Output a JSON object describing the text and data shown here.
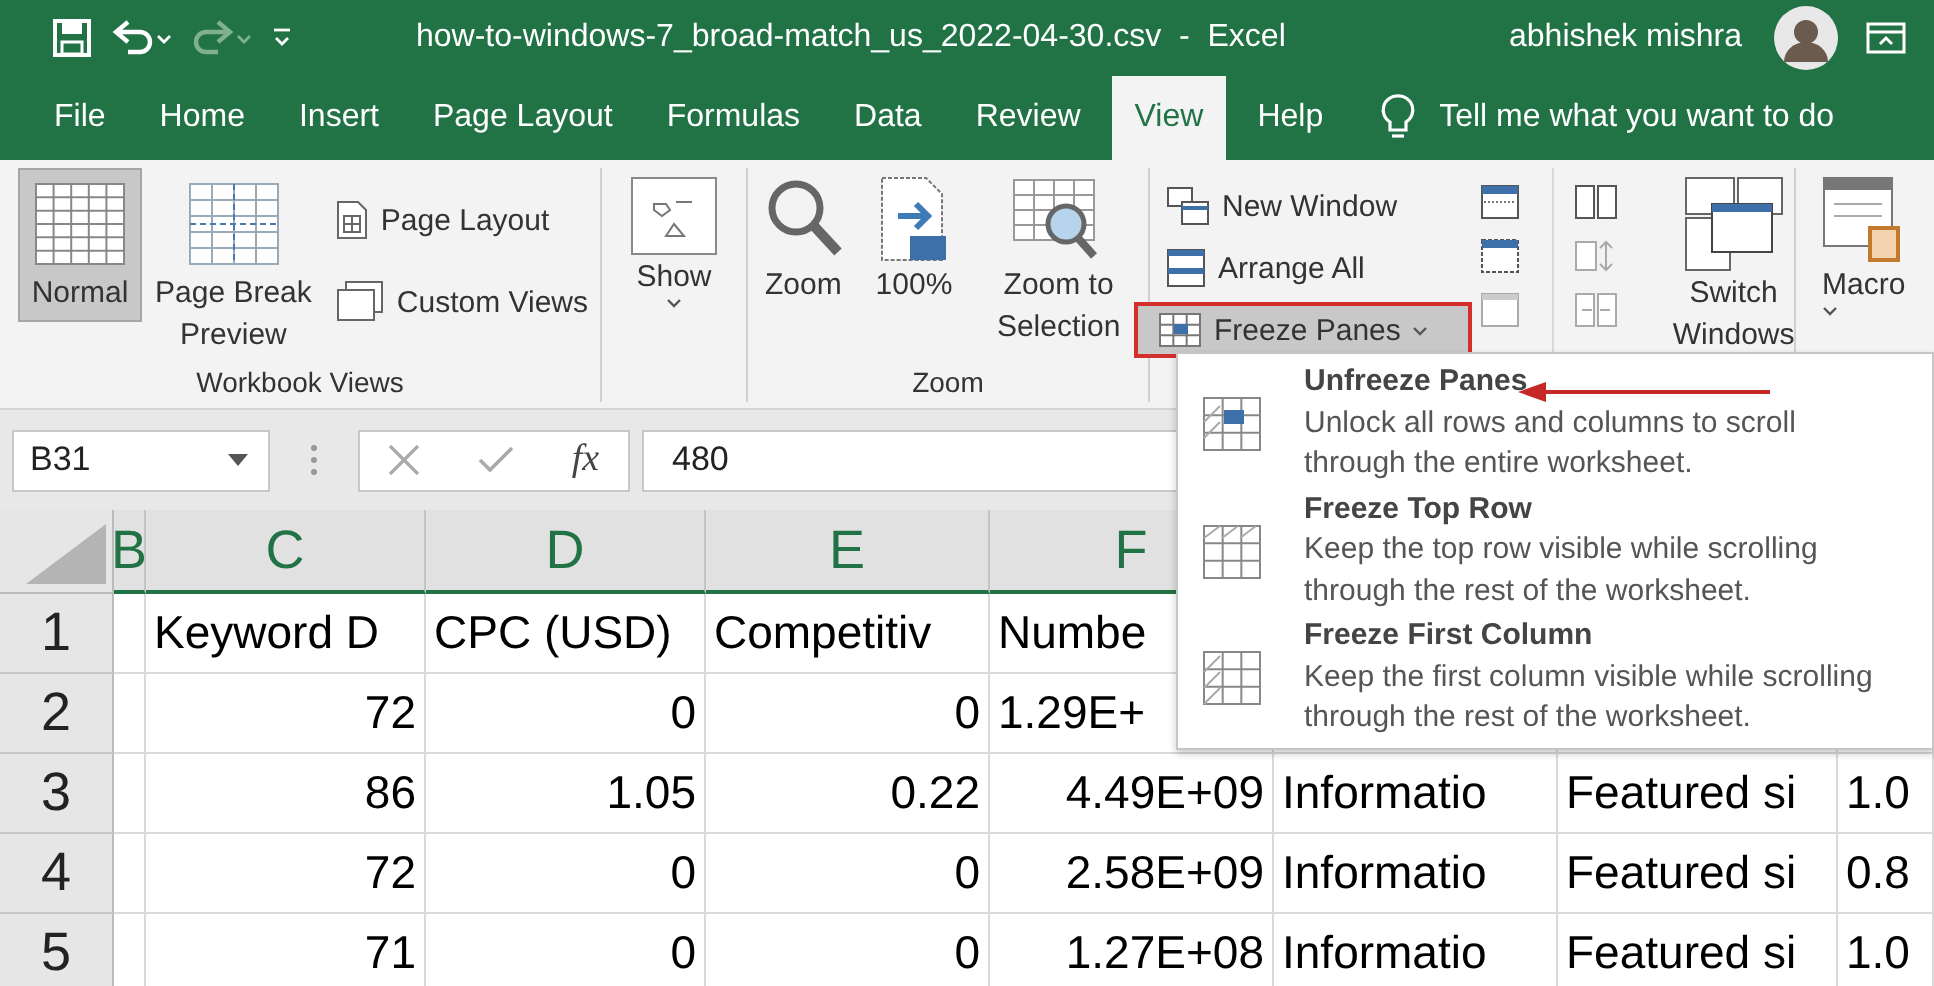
{
  "title_bar": {
    "title": "how-to-windows-7_broad-match_us_2022-04-30.csv  -  Excel",
    "user": "abhishek mishra"
  },
  "tabs": [
    {
      "label": "File",
      "selected": false
    },
    {
      "label": "Home",
      "selected": false
    },
    {
      "label": "Insert",
      "selected": false
    },
    {
      "label": "Page Layout",
      "selected": false
    },
    {
      "label": "Formulas",
      "selected": false
    },
    {
      "label": "Data",
      "selected": false
    },
    {
      "label": "Review",
      "selected": false
    },
    {
      "label": "View",
      "selected": true
    },
    {
      "label": "Help",
      "selected": false
    }
  ],
  "tell_me": "Tell me what you want to do",
  "workbook_views": {
    "label": "Workbook Views",
    "views": [
      {
        "label": "Normal",
        "selected": true
      },
      {
        "label": "Page Break Preview",
        "selected": false
      },
      {
        "label": "Page Layout",
        "selected": false
      },
      {
        "label": "Custom Views",
        "selected": false
      }
    ]
  },
  "show": {
    "label": "Show"
  },
  "zoom_group": {
    "label": "Zoom",
    "buttons": [
      "Zoom",
      "100%",
      "Zoom to Selection"
    ]
  },
  "window_group": {
    "new_window": "New Window",
    "arrange_all": "Arrange All",
    "freeze_panes": {
      "label": "Freeze Panes",
      "expanded": true,
      "highlighted": true
    },
    "switch_windows": "Switch Windows"
  },
  "macros": {
    "label": "Macro"
  },
  "freeze_menu": [
    {
      "title": "Unfreeze Panes",
      "description": "Unlock all rows and columns to scroll through the entire worksheet.",
      "pointed": true
    },
    {
      "title": "Freeze Top Row",
      "description": "Keep the top row visible while scrolling through the rest of the worksheet.",
      "pointed": false
    },
    {
      "title": "Freeze First Column",
      "description": "Keep the first column visible while scrolling through the rest of the worksheet.",
      "pointed": false
    }
  ],
  "formula_bar": {
    "name_box": "B31",
    "function_label": "fx",
    "value": "480"
  },
  "sheet": {
    "columns": [
      "B",
      "C",
      "D",
      "E",
      "F"
    ],
    "rows": [
      {
        "number": "1",
        "cells": [
          null,
          {
            "value": "Keyword D",
            "kind": "text"
          },
          {
            "value": "CPC (USD)",
            "kind": "text"
          },
          {
            "value": "Competitiv",
            "kind": "text"
          },
          {
            "value": "Numbe",
            "kind": "text"
          },
          null,
          null,
          null
        ]
      },
      {
        "number": "2",
        "cells": [
          null,
          {
            "value": "72",
            "kind": "number"
          },
          {
            "value": "0",
            "kind": "number"
          },
          {
            "value": "0",
            "kind": "number"
          },
          {
            "value": "1.29E+",
            "kind": "text"
          },
          null,
          null,
          null
        ]
      },
      {
        "number": "3",
        "cells": [
          null,
          {
            "value": "86",
            "kind": "number"
          },
          {
            "value": "1.05",
            "kind": "number"
          },
          {
            "value": "0.22",
            "kind": "number"
          },
          {
            "value": "4.49E+09",
            "kind": "number"
          },
          {
            "value": "Informatio",
            "kind": "text"
          },
          {
            "value": "Featured si",
            "kind": "text"
          },
          {
            "value": "1.0",
            "kind": "text"
          }
        ]
      },
      {
        "number": "4",
        "cells": [
          null,
          {
            "value": "72",
            "kind": "number"
          },
          {
            "value": "0",
            "kind": "number"
          },
          {
            "value": "0",
            "kind": "number"
          },
          {
            "value": "2.58E+09",
            "kind": "number"
          },
          {
            "value": "Informatio",
            "kind": "text"
          },
          {
            "value": "Featured si",
            "kind": "text"
          },
          {
            "value": "0.8",
            "kind": "text"
          }
        ]
      },
      {
        "number": "5",
        "cells": [
          null,
          {
            "value": "71",
            "kind": "number"
          },
          {
            "value": "0",
            "kind": "number"
          },
          {
            "value": "0",
            "kind": "number"
          },
          {
            "value": "1.27E+08",
            "kind": "number"
          },
          {
            "value": "Informatio",
            "kind": "text"
          },
          {
            "value": "Featured si",
            "kind": "text"
          },
          {
            "value": "1.0",
            "kind": "text"
          }
        ]
      }
    ]
  }
}
